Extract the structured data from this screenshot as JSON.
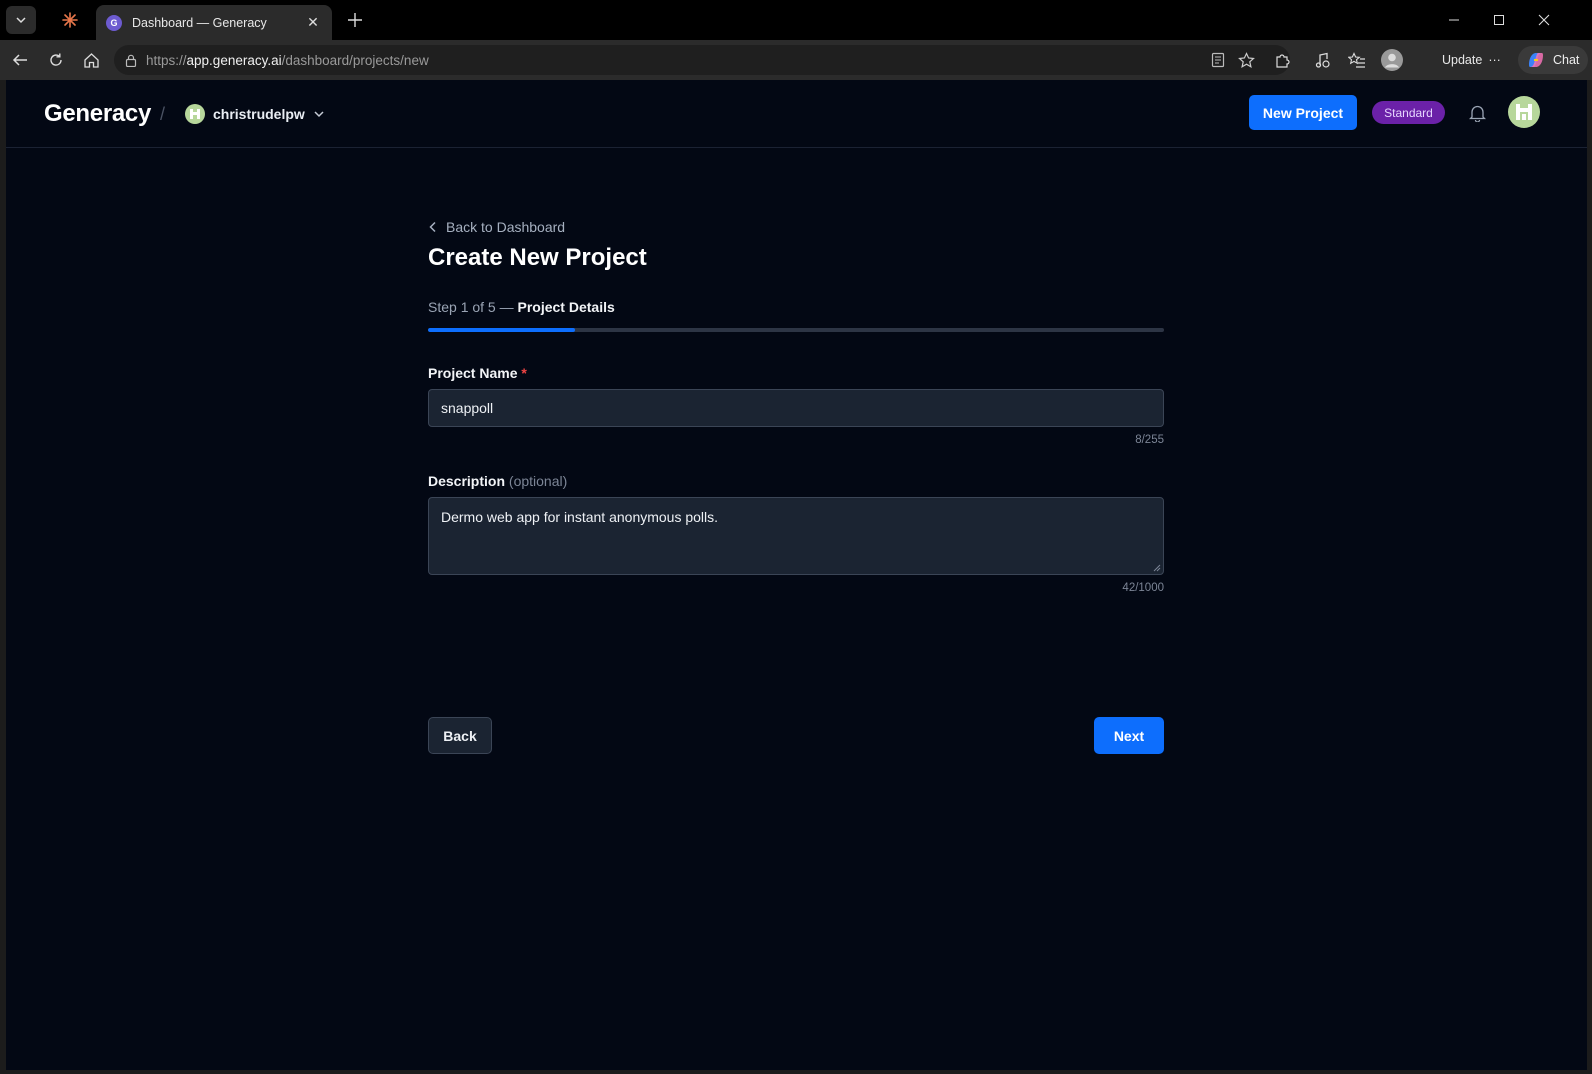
{
  "browser": {
    "tab_title": "Dashboard — Generacy",
    "tab_favicon_letter": "G",
    "url_scheme": "https://",
    "url_host": "app.generacy.ai",
    "url_path": "/dashboard/projects/new",
    "update_label": "Update",
    "update_more": "···",
    "chat_label": "Chat"
  },
  "header": {
    "brand": "Generacy",
    "separator": "/",
    "org_name": "christrudelpw",
    "new_project_label": "New Project",
    "plan_badge": "Standard"
  },
  "main": {
    "back_link": "Back to Dashboard",
    "title": "Create New Project",
    "step_prefix": "Step 1 of 5 —",
    "step_name": "Project Details",
    "progress": {
      "current_step": 1,
      "total_steps": 5
    },
    "project_name": {
      "label": "Project Name",
      "required_mark": "*",
      "value": "snappoll",
      "counter": "8/255"
    },
    "description": {
      "label": "Description",
      "optional_hint": "(optional)",
      "value": "Dermo web app for instant anonymous polls.",
      "counter": "42/1000"
    },
    "back_button": "Back",
    "next_button": "Next"
  },
  "colors": {
    "accent": "#0d6efd",
    "page_background": "#030814",
    "badge": "#6b21a8",
    "avatar": "#b7d79b",
    "required": "#ef4444"
  },
  "icons": {
    "back_link": "chevron-left-icon",
    "org_switch": "chevron-down-icon",
    "notifications": "bell-icon"
  }
}
